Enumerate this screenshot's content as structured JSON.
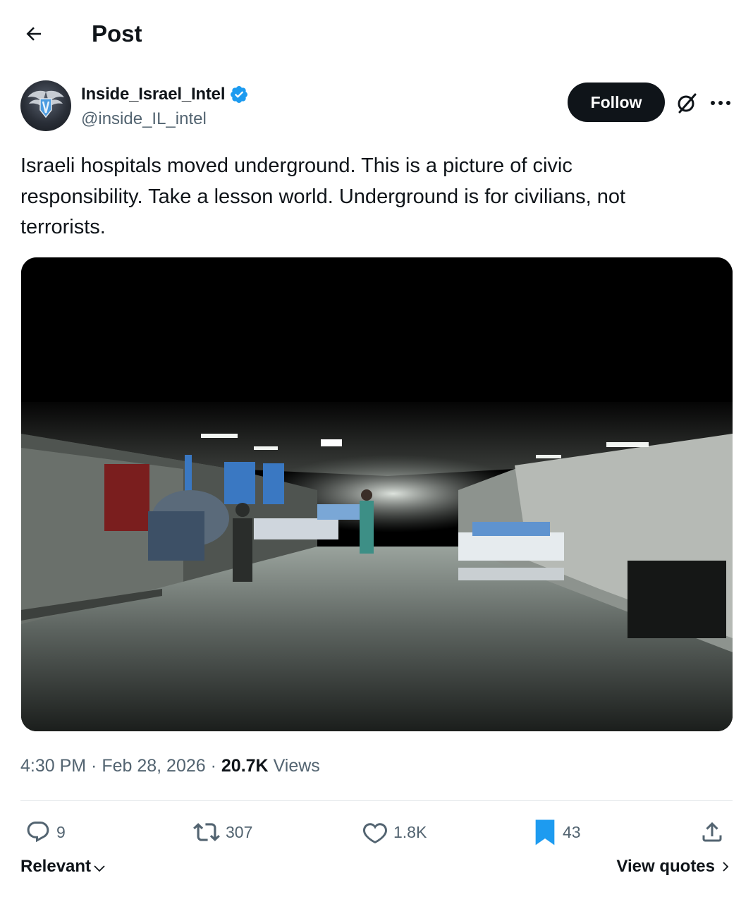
{
  "header": {
    "title": "Post",
    "back_icon": "arrow-left-icon"
  },
  "author": {
    "display_name": "Inside_Israel_Intel",
    "handle": "@inside_IL_intel",
    "verified": true,
    "verified_color": "#1d9bf0",
    "avatar_icon": "winged-shield-logo"
  },
  "follow_label": "Follow",
  "post": {
    "text": "Israeli hospitals moved underground. This is a picture of civic\nresponsibility. Take a lesson world. Underground is for civilians, not\nterrorists.",
    "media": {
      "type": "photo"
    }
  },
  "meta": {
    "time": "4:30 PM",
    "date": "Feb 28, 2026",
    "views_count": "20.7K",
    "views_label": "Views"
  },
  "actions": {
    "replies": "9",
    "reposts": "307",
    "likes": "1.8K",
    "bookmarks": "43",
    "bookmark_active": true,
    "bookmark_color": "#1d9bf0"
  },
  "footer": {
    "sort_label": "Relevant",
    "quotes_label": "View quotes"
  }
}
